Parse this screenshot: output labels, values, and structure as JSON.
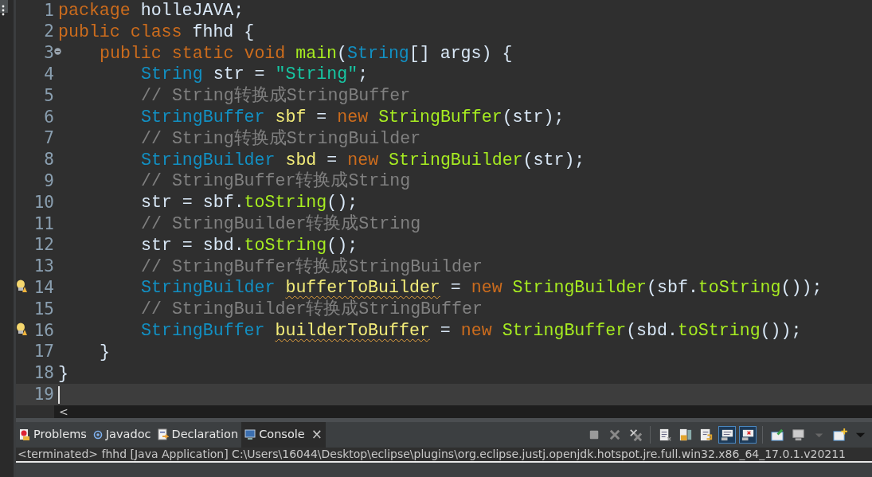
{
  "editor": {
    "lines": [
      {
        "number": "1",
        "current": false,
        "tokens": [
          {
            "text": "package ",
            "kind": "keyword"
          },
          {
            "text": "holleJAVA;",
            "kind": "plain"
          }
        ]
      },
      {
        "number": "2",
        "current": false,
        "tokens": [
          {
            "text": "public class ",
            "kind": "keyword"
          },
          {
            "text": "fhhd {",
            "kind": "plain"
          }
        ]
      },
      {
        "number": "3",
        "current": false,
        "marker": {
          "kind": "fold"
        },
        "tokens": [
          {
            "text": "\tpublic static void ",
            "kind": "keyword"
          },
          {
            "text": "main",
            "kind": "method"
          },
          {
            "text": "(",
            "kind": "plain"
          },
          {
            "text": "String",
            "kind": "type"
          },
          {
            "text": "[] args) {",
            "kind": "plain"
          }
        ]
      },
      {
        "number": "4",
        "current": false,
        "tokens": [
          {
            "text": "\t\tString ",
            "kind": "type"
          },
          {
            "text": "str = ",
            "kind": "plain"
          },
          {
            "text": "\"String\"",
            "kind": "string"
          },
          {
            "text": ";",
            "kind": "plain"
          }
        ]
      },
      {
        "number": "5",
        "current": false,
        "tokens": [
          {
            "text": "\t\t// String转换成StringBuffer",
            "kind": "comment"
          }
        ]
      },
      {
        "number": "6",
        "current": false,
        "tokens": [
          {
            "text": "\t\tStringBuffer ",
            "kind": "type"
          },
          {
            "text": "sbf",
            "kind": "variable"
          },
          {
            "text": " = ",
            "kind": "plain"
          },
          {
            "text": "new ",
            "kind": "keyword"
          },
          {
            "text": "StringBuffer",
            "kind": "method"
          },
          {
            "text": "(str);",
            "kind": "plain"
          }
        ]
      },
      {
        "number": "7",
        "current": false,
        "tokens": [
          {
            "text": "\t\t// String转换成StringBuilder",
            "kind": "comment"
          }
        ]
      },
      {
        "number": "8",
        "current": false,
        "tokens": [
          {
            "text": "\t\tStringBuilder ",
            "kind": "type"
          },
          {
            "text": "sbd",
            "kind": "variable"
          },
          {
            "text": " = ",
            "kind": "plain"
          },
          {
            "text": "new ",
            "kind": "keyword"
          },
          {
            "text": "StringBuilder",
            "kind": "method"
          },
          {
            "text": "(str);",
            "kind": "plain"
          }
        ]
      },
      {
        "number": "9",
        "current": false,
        "tokens": [
          {
            "text": "\t\t// StringBuffer转换成String",
            "kind": "comment"
          }
        ]
      },
      {
        "number": "10",
        "current": false,
        "tokens": [
          {
            "text": "\t\tstr = sbf.",
            "kind": "plain"
          },
          {
            "text": "toString",
            "kind": "method"
          },
          {
            "text": "();",
            "kind": "plain"
          }
        ]
      },
      {
        "number": "11",
        "current": false,
        "tokens": [
          {
            "text": "\t\t// StringBuilder转换成String",
            "kind": "comment"
          }
        ]
      },
      {
        "number": "12",
        "current": false,
        "tokens": [
          {
            "text": "\t\tstr = sbd.",
            "kind": "plain"
          },
          {
            "text": "toString",
            "kind": "method"
          },
          {
            "text": "();",
            "kind": "plain"
          }
        ]
      },
      {
        "number": "13",
        "current": false,
        "tokens": [
          {
            "text": "\t\t// StringBuffer转换成StringBuilder",
            "kind": "comment"
          }
        ]
      },
      {
        "number": "14",
        "current": false,
        "marker": {
          "kind": "warning"
        },
        "tokens": [
          {
            "text": "\t\tStringBuilder ",
            "kind": "type"
          },
          {
            "text": "bufferToBuilder",
            "kind": "warning"
          },
          {
            "text": " = ",
            "kind": "plain"
          },
          {
            "text": "new ",
            "kind": "keyword"
          },
          {
            "text": "StringBuilder",
            "kind": "method"
          },
          {
            "text": "(sbf.",
            "kind": "plain"
          },
          {
            "text": "toString",
            "kind": "method"
          },
          {
            "text": "());",
            "kind": "plain"
          }
        ]
      },
      {
        "number": "15",
        "current": false,
        "tokens": [
          {
            "text": "\t\t// StringBuilder转换成StringBuffer",
            "kind": "comment"
          }
        ]
      },
      {
        "number": "16",
        "current": false,
        "marker": {
          "kind": "warning"
        },
        "tokens": [
          {
            "text": "\t\tStringBuffer ",
            "kind": "type"
          },
          {
            "text": "builderToBuffer",
            "kind": "warning"
          },
          {
            "text": " = ",
            "kind": "plain"
          },
          {
            "text": "new ",
            "kind": "keyword"
          },
          {
            "text": "StringBuffer",
            "kind": "method"
          },
          {
            "text": "(sbd.",
            "kind": "plain"
          },
          {
            "text": "toString",
            "kind": "method"
          },
          {
            "text": "());",
            "kind": "plain"
          }
        ]
      },
      {
        "number": "17",
        "current": false,
        "tokens": [
          {
            "text": "\t}",
            "kind": "plain"
          }
        ]
      },
      {
        "number": "18",
        "current": false,
        "tokens": [
          {
            "text": "}",
            "kind": "plain"
          }
        ]
      },
      {
        "number": "19",
        "current": true
      }
    ],
    "scroll_arrow": "<"
  },
  "panel": {
    "tabs": [
      {
        "label": "Problems",
        "kind": "problems",
        "selected": false
      },
      {
        "label": "Javadoc",
        "kind": "javadoc",
        "selected": false
      },
      {
        "label": "Declaration",
        "kind": "declaration",
        "selected": false
      },
      {
        "label": "Console",
        "kind": "console",
        "selected": true,
        "close": "×"
      }
    ],
    "toolbar": [
      {
        "kind": "terminate",
        "selected": false
      },
      {
        "kind": "remove",
        "selected": false
      },
      {
        "kind": "remove-all",
        "selected": false
      },
      {
        "kind": "sep"
      },
      {
        "kind": "clear",
        "selected": false
      },
      {
        "kind": "lock",
        "selected": false
      },
      {
        "kind": "wrap",
        "selected": false
      },
      {
        "kind": "show-out",
        "selected": true
      },
      {
        "kind": "show-err",
        "selected": true
      },
      {
        "kind": "sep"
      },
      {
        "kind": "pin",
        "selected": false
      },
      {
        "kind": "display",
        "selected": false
      },
      {
        "kind": "dropdown",
        "selected": false
      },
      {
        "kind": "new-console",
        "selected": false
      },
      {
        "kind": "menu",
        "selected": false
      }
    ],
    "console_line": "<terminated> fhhd [Java Application] C:\\Users\\16044\\Desktop\\eclipse\\plugins\\org.eclipse.justj.openjdk.hotspot.jre.full.win32.x86_64_17.0.1.v20211"
  }
}
